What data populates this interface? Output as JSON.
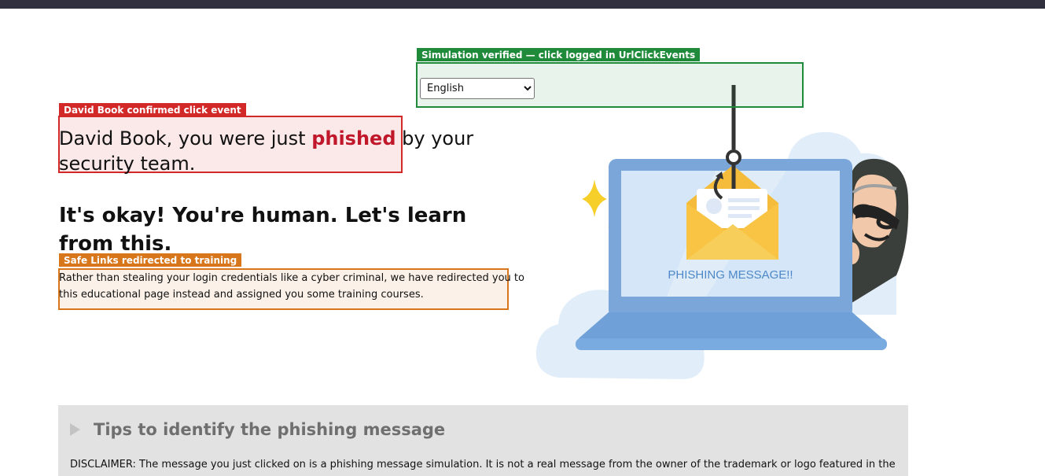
{
  "annotations": {
    "verified": "Simulation verified — click logged in UrlClickEvents",
    "click_event": "David Book confirmed click event",
    "safe_links": "Safe Links redirected to training"
  },
  "language": {
    "selected": "English",
    "options": [
      "English"
    ]
  },
  "headline": {
    "prefix": "David Book, you were just ",
    "emphasis": "phished",
    "suffix": " by your security team."
  },
  "subheading": "It's okay! You're human. Let's learn from this.",
  "paragraph": "Rather than stealing your login credentials like a cyber criminal, we have redirected you to this educational page instead and assigned you some training courses.",
  "illustration": {
    "caption": "PHISHING MESSAGE!!"
  },
  "tips": {
    "title": "Tips to identify the phishing message",
    "disclaimer": "DISCLAIMER: The message you just clicked on is a phishing message simulation. It is not a real message from the owner of the trademark or logo featured in the"
  },
  "colors": {
    "verified_green": "#1e8a3a",
    "alert_red": "#d32828",
    "warning_orange": "#d7761a",
    "phished_red": "#c0182a",
    "topbar": "#30303f",
    "laptop_blue": "#7aa6da",
    "envelope_yellow": "#f9c443"
  }
}
